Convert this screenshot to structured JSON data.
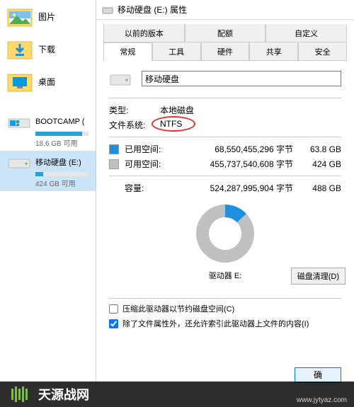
{
  "sidebar": {
    "folders": [
      {
        "name": "图片"
      },
      {
        "name": "下载"
      },
      {
        "name": "桌面"
      }
    ],
    "drives": [
      {
        "name": "BOOTCAMP (",
        "sub": "18.6 GB 可用",
        "fill_pct": 88
      },
      {
        "name": "移动硬盘 (E:)",
        "sub": "424 GB 可用",
        "fill_pct": 14
      }
    ]
  },
  "dialog": {
    "title": "移动硬盘 (E:) 属性",
    "tabs_row1": [
      "以前的版本",
      "配额",
      "自定义"
    ],
    "tabs_row2": [
      "常规",
      "工具",
      "硬件",
      "共享",
      "安全"
    ],
    "drive_name_value": "移动硬盘",
    "type_label": "类型:",
    "type_value": "本地磁盘",
    "fs_label": "文件系统:",
    "fs_value": "NTFS",
    "used_label": "已用空间:",
    "used_bytes": "68,550,455,296 字节",
    "used_gb": "63.8 GB",
    "free_label": "可用空间:",
    "free_bytes": "455,737,540,608 字节",
    "free_gb": "424 GB",
    "capacity_label": "容量:",
    "capacity_bytes": "524,287,995,904 字节",
    "capacity_gb": "488 GB",
    "drive_below": "驱动器 E:",
    "cleanup_btn": "磁盘清理(D)",
    "compress_cb": "压缩此驱动器以节约磁盘空间(C)",
    "index_cb": "除了文件属性外，还允许索引此驱动器上文件的内容(I)",
    "ok_btn": "确"
  },
  "chart_data": {
    "type": "pie",
    "title": "",
    "series": [
      {
        "name": "已用空间",
        "value": 68550455296,
        "color": "#1e90dd"
      },
      {
        "name": "可用空间",
        "value": 455737540608,
        "color": "#c0c0c0"
      }
    ]
  },
  "watermark": {
    "text": "天源战网",
    "link": "www.jytyaz.com"
  }
}
